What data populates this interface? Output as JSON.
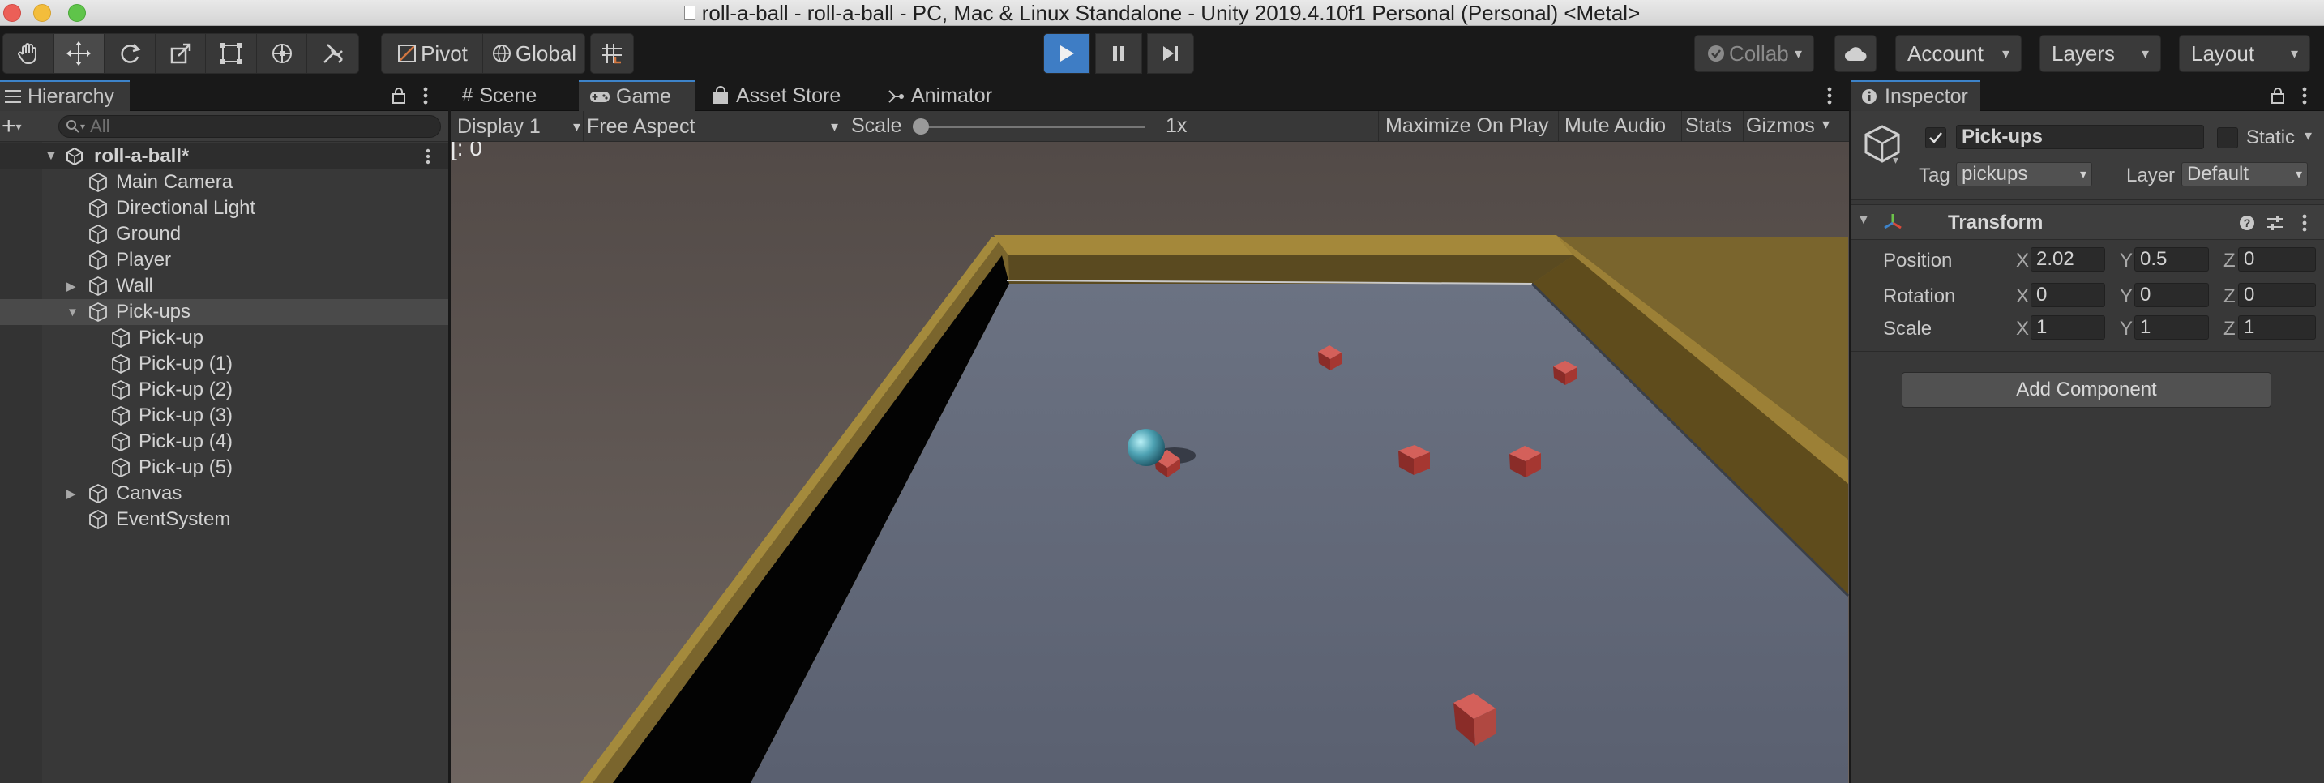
{
  "window": {
    "title": "roll-a-ball - roll-a-ball - PC, Mac & Linux Standalone - Unity 2019.4.10f1 Personal (Personal) <Metal>"
  },
  "toolbar": {
    "pivot_label": "Pivot",
    "global_label": "Global",
    "collab_label": "Collab",
    "account_label": "Account",
    "layers_label": "Layers",
    "layout_label": "Layout"
  },
  "hierarchy": {
    "tab_label": "Hierarchy",
    "search_placeholder": "All",
    "scene_name": "roll-a-ball*",
    "items": [
      {
        "label": "Main Camera",
        "depth": 1,
        "fold": ""
      },
      {
        "label": "Directional Light",
        "depth": 1,
        "fold": ""
      },
      {
        "label": "Ground",
        "depth": 1,
        "fold": ""
      },
      {
        "label": "Player",
        "depth": 1,
        "fold": ""
      },
      {
        "label": "Wall",
        "depth": 1,
        "fold": "collapsed"
      },
      {
        "label": "Pick-ups",
        "depth": 1,
        "fold": "expanded",
        "selected": true
      },
      {
        "label": "Pick-up",
        "depth": 2,
        "fold": ""
      },
      {
        "label": "Pick-up (1)",
        "depth": 2,
        "fold": ""
      },
      {
        "label": "Pick-up (2)",
        "depth": 2,
        "fold": ""
      },
      {
        "label": "Pick-up (3)",
        "depth": 2,
        "fold": ""
      },
      {
        "label": "Pick-up (4)",
        "depth": 2,
        "fold": ""
      },
      {
        "label": "Pick-up (5)",
        "depth": 2,
        "fold": ""
      },
      {
        "label": "Canvas",
        "depth": 1,
        "fold": "collapsed"
      },
      {
        "label": "EventSystem",
        "depth": 1,
        "fold": ""
      }
    ]
  },
  "center_tabs": {
    "scene": "Scene",
    "game": "Game",
    "asset_store": "Asset Store",
    "animator": "Animator"
  },
  "game_toolbar": {
    "display": "Display 1",
    "aspect": "Free Aspect",
    "scale_label": "Scale",
    "scale_value": "1x",
    "maximize": "Maximize On Play",
    "mute": "Mute Audio",
    "stats": "Stats",
    "gizmos": "Gizmos"
  },
  "game_view": {
    "overlay_text": "[: 0"
  },
  "inspector": {
    "tab_label": "Inspector",
    "object_name": "Pick-ups",
    "active_checked": true,
    "static_label": "Static",
    "tag_label": "Tag",
    "tag_value": "pickups",
    "layer_label": "Layer",
    "layer_value": "Default",
    "transform_title": "Transform",
    "position_label": "Position",
    "rotation_label": "Rotation",
    "scale_label": "Scale",
    "axis_x": "X",
    "axis_y": "Y",
    "axis_z": "Z",
    "position": {
      "x": "2.02",
      "y": "0.5",
      "z": "0"
    },
    "rotation": {
      "x": "0",
      "y": "0",
      "z": "0"
    },
    "scale": {
      "x": "1",
      "y": "1",
      "z": "1"
    },
    "add_component": "Add Component"
  },
  "colors": {
    "accent_blue": "#3d83c9",
    "panel_bg": "#383838",
    "selected_row": "#4a4a4a",
    "wall_gold": "#9c8036",
    "floor": "#5f6777",
    "pickup_red": "#b8403c"
  }
}
